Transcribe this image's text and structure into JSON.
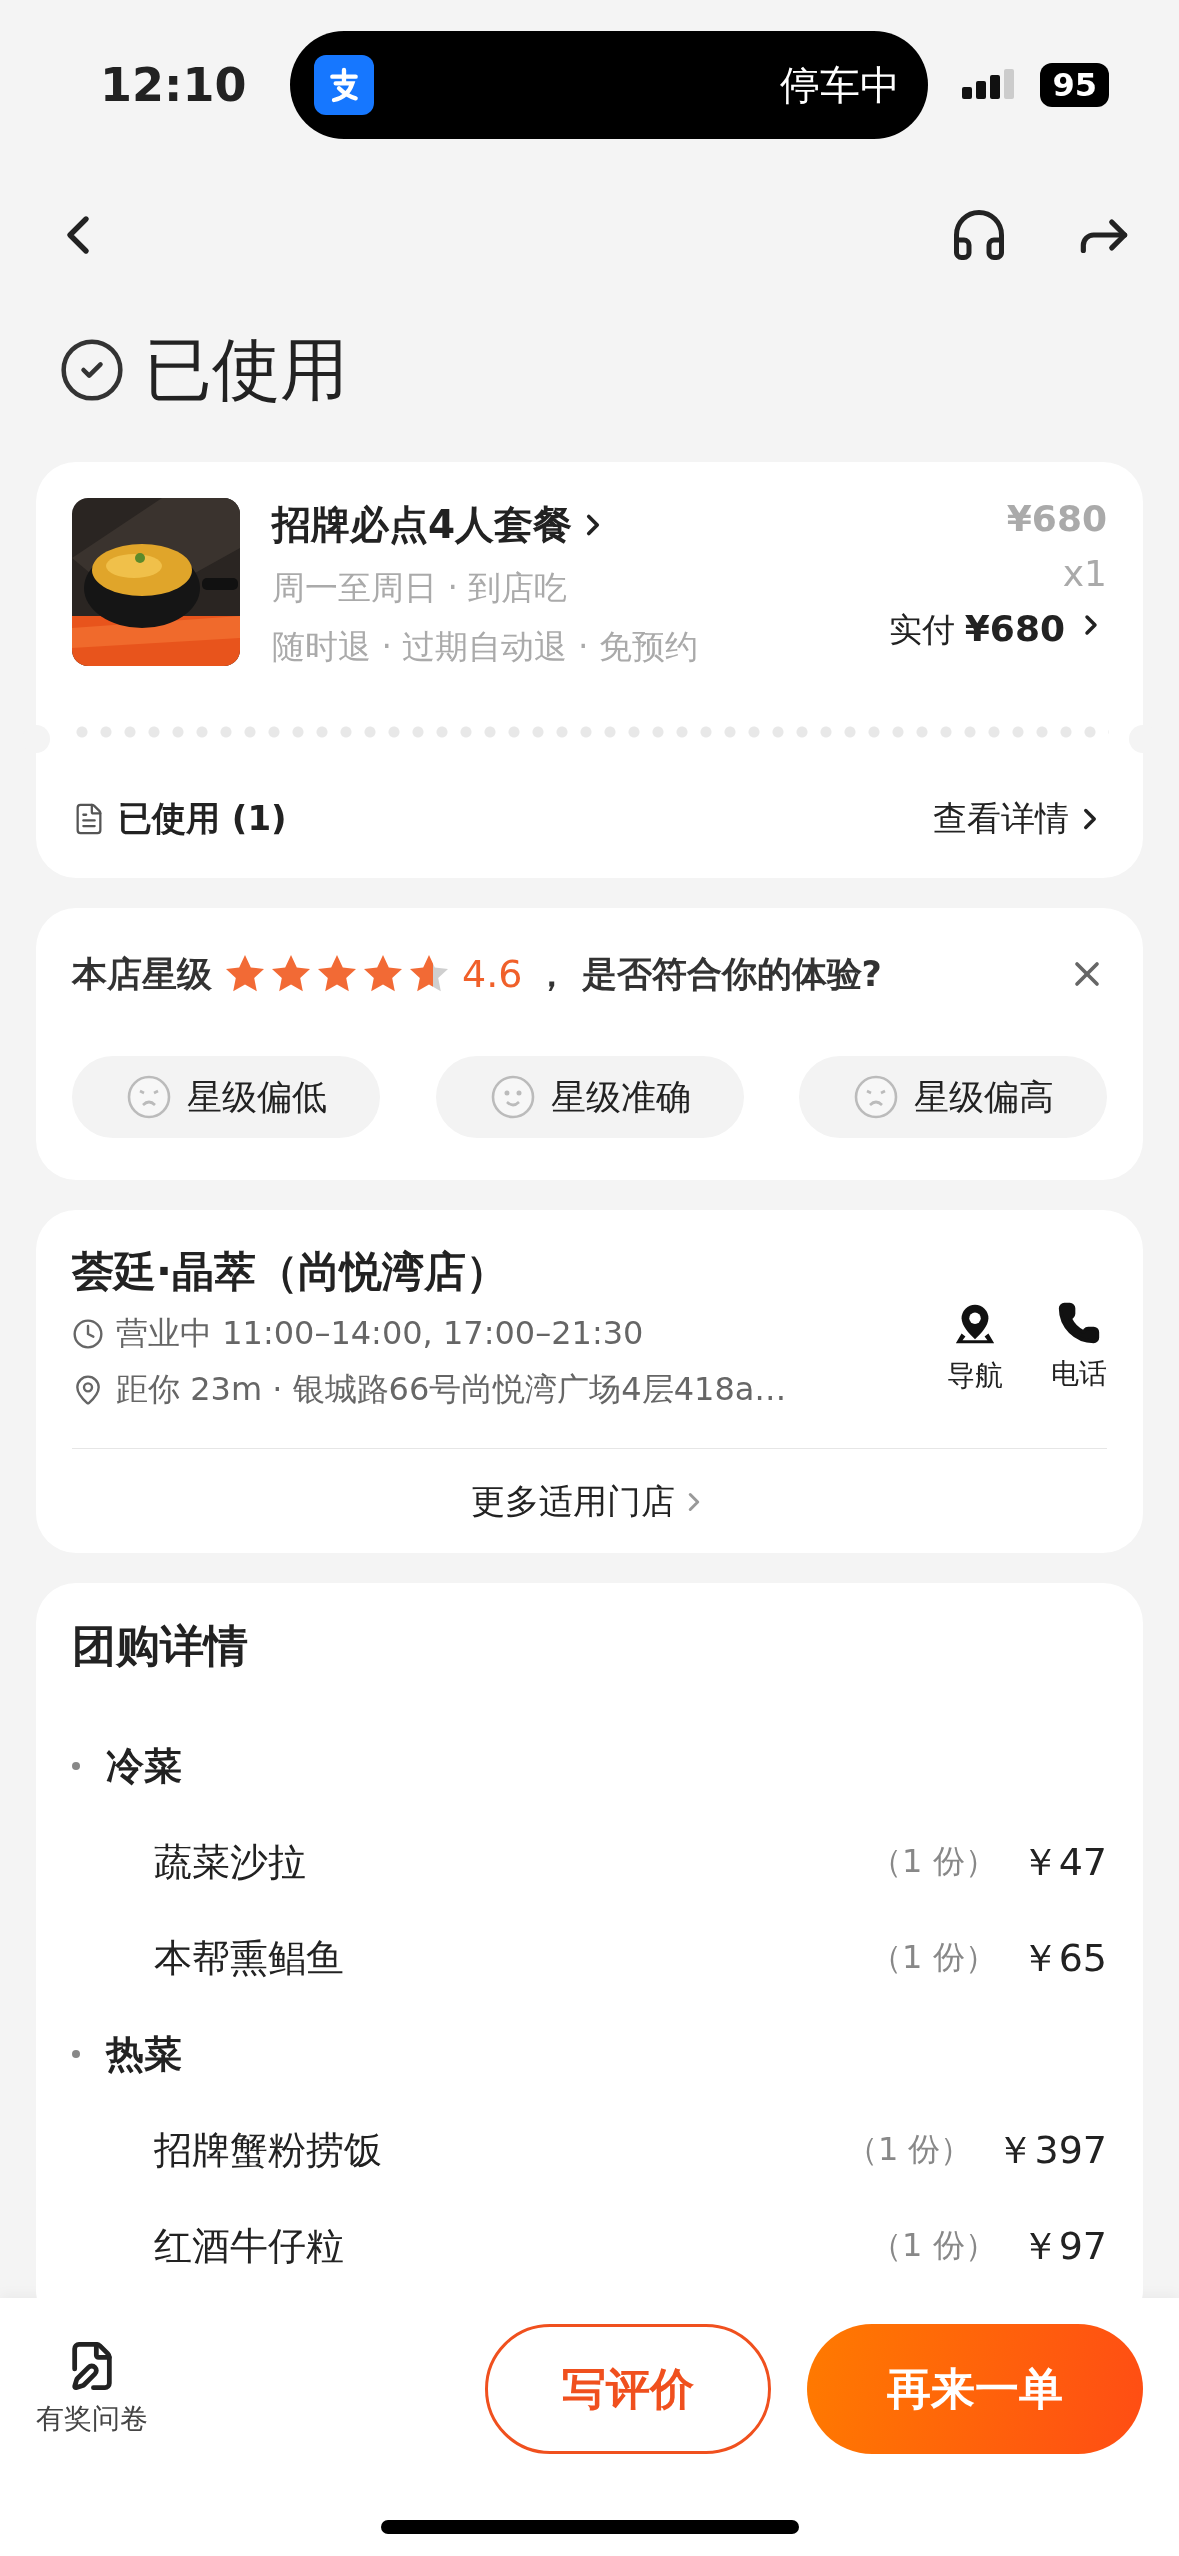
{
  "status_bar": {
    "time": "12:10",
    "activity": "停车中",
    "battery": "95"
  },
  "status": {
    "title": "已使用"
  },
  "order": {
    "title": "招牌必点4人套餐",
    "schedule": "周一至周日 · 到店吃",
    "policies": "随时退 · 过期自动退 · 免预约",
    "price": "¥680",
    "quantity": "x1",
    "paid_label": "实付",
    "paid_amount": "¥680",
    "used_label": "已使用 (1)",
    "details_link": "查看详情"
  },
  "rating": {
    "label": "本店星级",
    "stars": 4.6,
    "score": "4.6",
    "question": "， 是否符合你的体验?",
    "options": [
      {
        "kind": "frown",
        "label": "星级偏低"
      },
      {
        "kind": "smile",
        "label": "星级准确"
      },
      {
        "kind": "frown",
        "label": "星级偏高"
      }
    ]
  },
  "store": {
    "name": "荟廷·晶萃（尚悦湾店）",
    "hours": "营业中 11:00–14:00, 17:00–21:30",
    "location": "距你 23m ·  银城路66号尚悦湾广场4层418a…",
    "actions": [
      {
        "kind": "navigate",
        "label": "导航"
      },
      {
        "kind": "phone",
        "label": "电话"
      }
    ],
    "more_link": "更多适用门店"
  },
  "details": {
    "title": "团购详情",
    "groups": [
      {
        "name": "冷菜",
        "items": [
          {
            "name": "蔬菜沙拉",
            "quantity": "（1 份）",
            "price": "￥47"
          },
          {
            "name": "本帮熏鲳鱼",
            "quantity": "（1 份）",
            "price": "￥65"
          }
        ]
      },
      {
        "name": "热菜",
        "items": [
          {
            "name": "招牌蟹粉捞饭",
            "quantity": "（1 份）",
            "price": "￥397"
          },
          {
            "name": "红酒牛仔粒",
            "quantity": "（1 份）",
            "price": "￥97"
          }
        ]
      }
    ]
  },
  "bottom_bar": {
    "survey": "有奖问卷",
    "buttons": [
      {
        "kind": "outline",
        "label": "写评价"
      },
      {
        "kind": "primary",
        "label": "再来一单"
      }
    ]
  }
}
